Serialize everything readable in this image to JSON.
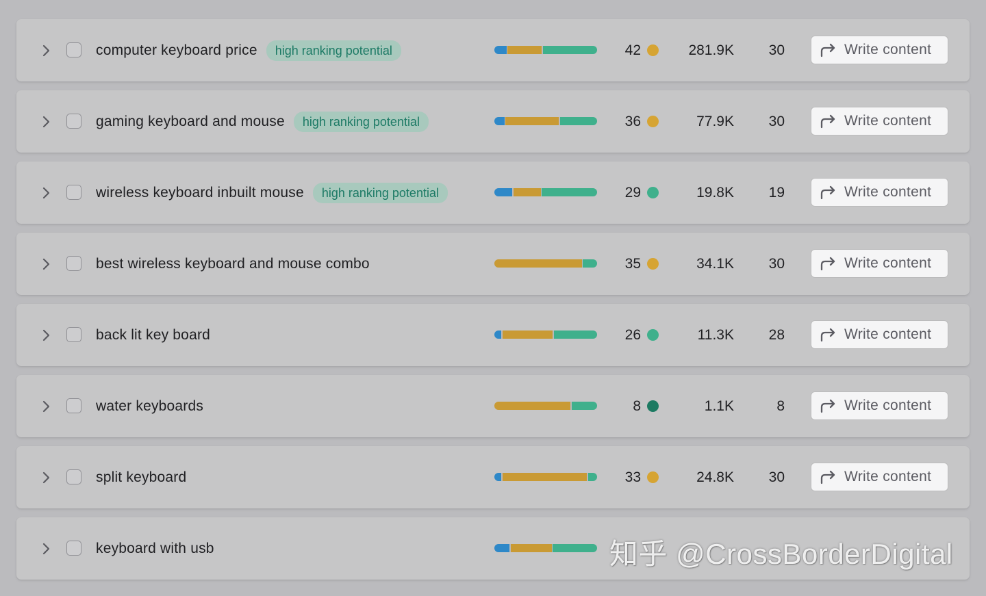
{
  "rows": [
    {
      "keyword": "computer keyboard price",
      "badge": "high ranking potential",
      "bar": [
        0.12,
        0.34,
        0.54
      ],
      "kd": "42",
      "kd_color": "#d6a433",
      "volume": "281.9K",
      "count": "30",
      "action": "Write content"
    },
    {
      "keyword": "gaming keyboard and mouse",
      "badge": "high ranking potential",
      "bar": [
        0.1,
        0.53,
        0.37
      ],
      "kd": "36",
      "kd_color": "#d6a433",
      "volume": "77.9K",
      "count": "30",
      "action": "Write content"
    },
    {
      "keyword": "wireless keyboard inbuilt mouse",
      "badge": "high ranking potential",
      "bar": [
        0.18,
        0.27,
        0.55
      ],
      "kd": "29",
      "kd_color": "#3fb08c",
      "volume": "19.8K",
      "count": "19",
      "action": "Write content"
    },
    {
      "keyword": "best wireless keyboard and mouse combo",
      "badge": "",
      "bar": [
        0.0,
        0.86,
        0.14
      ],
      "kd": "35",
      "kd_color": "#d6a433",
      "volume": "34.1K",
      "count": "30",
      "action": "Write content"
    },
    {
      "keyword": "back lit key board",
      "badge": "",
      "bar": [
        0.07,
        0.5,
        0.43
      ],
      "kd": "26",
      "kd_color": "#3fb08c",
      "volume": "11.3K",
      "count": "28",
      "action": "Write content"
    },
    {
      "keyword": "water keyboards",
      "badge": "",
      "bar": [
        0.0,
        0.75,
        0.25
      ],
      "kd": "8",
      "kd_color": "#1c7a62",
      "volume": "1.1K",
      "count": "8",
      "action": "Write content"
    },
    {
      "keyword": "split keyboard",
      "badge": "",
      "bar": [
        0.07,
        0.84,
        0.09
      ],
      "kd": "33",
      "kd_color": "#d6a433",
      "volume": "24.8K",
      "count": "30",
      "action": "Write content"
    },
    {
      "keyword": "keyboard with usb",
      "badge": "",
      "bar": [
        0.15,
        0.41,
        0.44
      ],
      "kd": "",
      "kd_color": "",
      "volume": "",
      "count": "",
      "action": ""
    }
  ],
  "watermark": "知乎 @CrossBorderDigital",
  "icons": {
    "expand": "chevron-right-icon",
    "action": "share-arrow-icon"
  },
  "colors": {
    "bar_blue": "#2e88c8",
    "bar_orange": "#c99a34",
    "bar_green": "#3fb08c",
    "badge_text": "#1c7a65",
    "badge_bg": "#a8c9bd"
  }
}
